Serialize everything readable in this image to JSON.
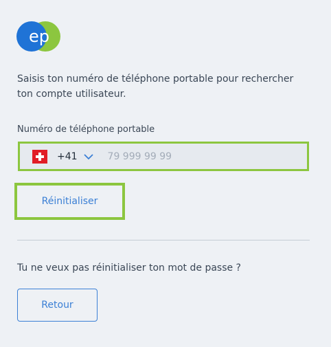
{
  "logo": {
    "text": "ep",
    "colors": {
      "blue": "#1f73d6",
      "green": "#8cc63f"
    }
  },
  "intro_text": "Saisis ton numéro de téléphone portable pour rechercher ton compte utilisateur.",
  "phone": {
    "label": "Numéro de téléphone portable",
    "country_flag": "switzerland-flag",
    "dial_code": "+41",
    "placeholder": "79 999 99 99",
    "value": ""
  },
  "reset_button_label": "Réinitialiser",
  "question_text": "Tu ne veux pas réinitialiser ton mot de passe ?",
  "back_button_label": "Retour",
  "colors": {
    "accent": "#3a7fd5",
    "highlight": "#8cc63f",
    "background": "#eef1f5"
  }
}
